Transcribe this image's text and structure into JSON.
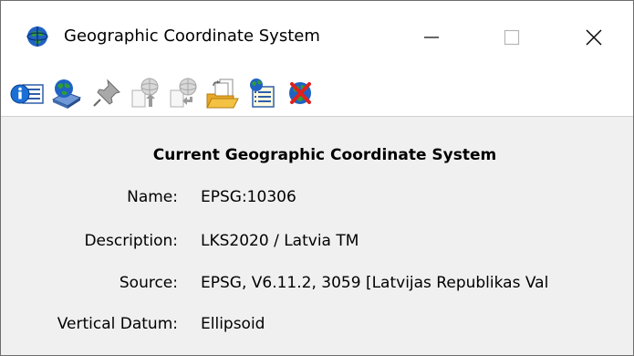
{
  "window": {
    "title": "Geographic Coordinate System",
    "icon": "globe-icon",
    "controls": {
      "minimize": "minimize-icon",
      "maximize": "maximize-icon",
      "close": "close-icon"
    }
  },
  "toolbar": {
    "items": [
      {
        "name": "info-properties-button",
        "icon": "info-list-icon"
      },
      {
        "name": "select-from-library-button",
        "icon": "globe-library-icon"
      },
      {
        "name": "pin-button",
        "icon": "pushpin-icon"
      },
      {
        "name": "import-button",
        "icon": "globe-import-icon"
      },
      {
        "name": "export-button",
        "icon": "globe-export-icon"
      },
      {
        "name": "open-from-file-button",
        "icon": "folder-open-icon"
      },
      {
        "name": "from-element-button",
        "icon": "globe-list-icon"
      },
      {
        "name": "delete-button",
        "icon": "globe-delete-icon"
      }
    ]
  },
  "current": {
    "heading": "Current Geographic Coordinate System",
    "fields": [
      {
        "label": "Name:",
        "value": "EPSG:10306"
      },
      {
        "label": "Description:",
        "value": "LKS2020 / Latvia TM"
      },
      {
        "label": "Source:",
        "value": "EPSG, V6.11.2, 3059 [Latvijas Republikas Val"
      },
      {
        "label": "Vertical Datum:",
        "value": "Ellipsoid"
      }
    ]
  },
  "colors": {
    "globe_blue": "#1f62c4",
    "globe_green": "#2e9b3a",
    "folder_yellow": "#f3c243",
    "delete_red": "#e0201c",
    "background": "#f0f0f0"
  }
}
